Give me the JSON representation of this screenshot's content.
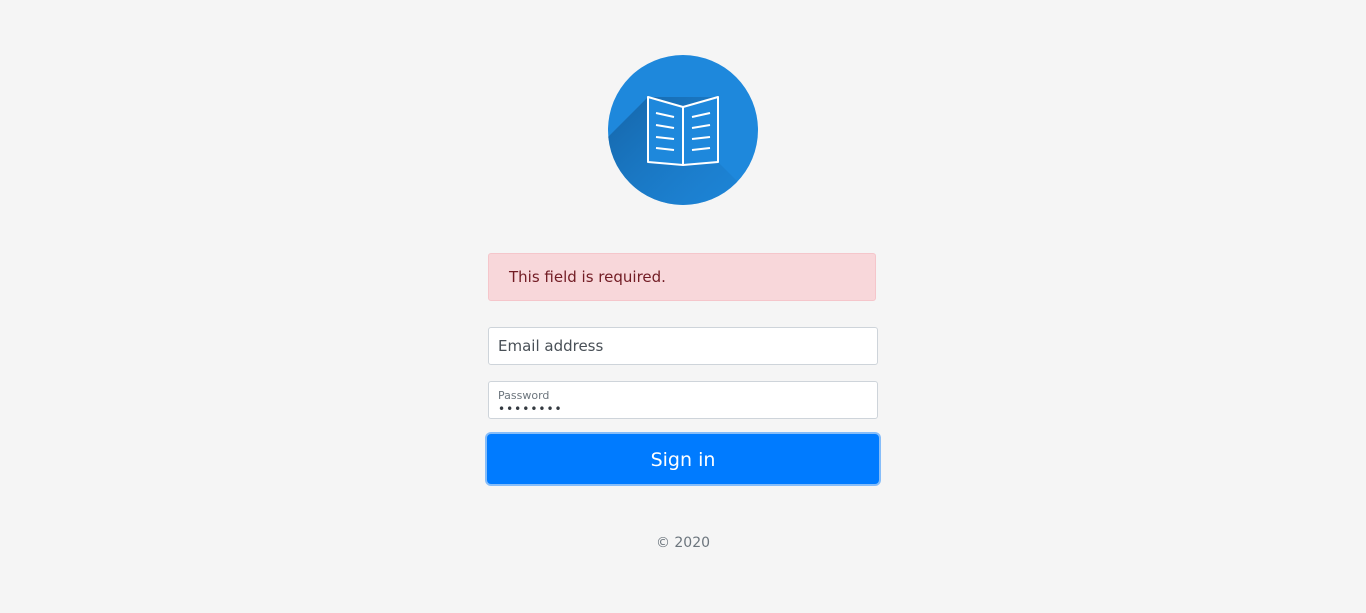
{
  "logo": {
    "icon": "open-book-icon",
    "color": "#1e88dc"
  },
  "alert": {
    "message": "This field is required."
  },
  "form": {
    "email": {
      "placeholder": "Email address",
      "value": ""
    },
    "password": {
      "label": "Password",
      "value": "••••••••"
    },
    "submit_label": "Sign in"
  },
  "footer": {
    "text": "© 2020"
  },
  "colors": {
    "background": "#f5f5f5",
    "primary": "#007bff",
    "alert_bg": "#f8d7da",
    "alert_text": "#721c24"
  }
}
